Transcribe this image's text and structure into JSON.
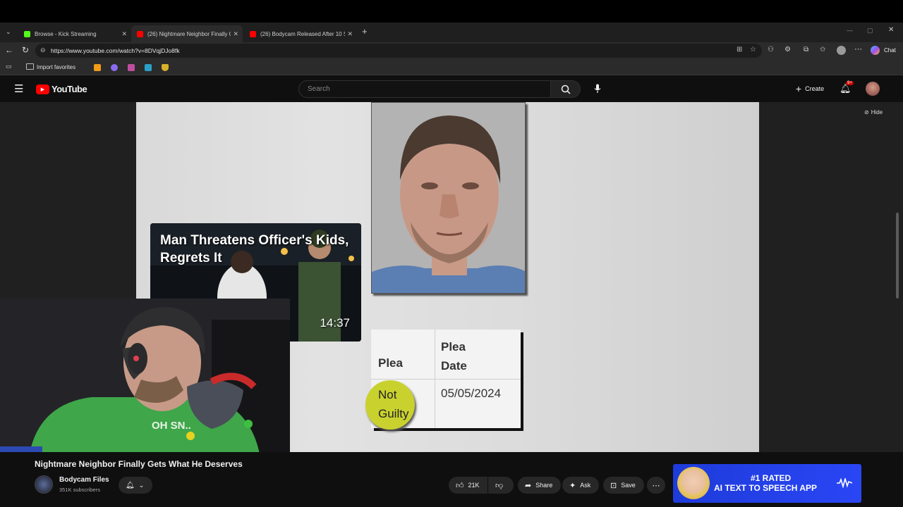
{
  "browser": {
    "tabs": [
      {
        "label": "Browse - Kick Streaming",
        "favicon_color": "#53fc18"
      },
      {
        "label": "(26) Nightmare Neighbor Finally G",
        "favicon_color": "#ff0000"
      },
      {
        "label": "(26) Bodycam Released After 10 S",
        "favicon_color": "#ff0000"
      }
    ],
    "url": "https://www.youtube.com/watch?v=8DVqjDJo8fk",
    "copilot_label": "Chat",
    "bookmarks": {
      "import_label": "Import favorites"
    }
  },
  "youtube": {
    "logo_text": "YouTube",
    "search_placeholder": "Search",
    "create_label": "Create",
    "notification_badge": "9+",
    "hide_label": "Hide"
  },
  "video_frame": {
    "thumbnail_title": "Man Threatens Officer's Kids, Regrets It",
    "thumbnail_duration": "14:37",
    "plea_table": {
      "headers": [
        "Plea",
        "Plea Date"
      ],
      "row": [
        "Not Guilty",
        "05/05/2024"
      ]
    },
    "shirt_text": "OH SN..."
  },
  "video_info": {
    "title": "Nightmare Neighbor Finally Gets What He Deserves",
    "channel": "Bodycam Files",
    "subscribers": "351K subscribers",
    "likes": "21K",
    "share_label": "Share",
    "ask_label": "Ask",
    "save_label": "Save"
  },
  "ad": {
    "line1": "#1 RATED",
    "line2": "AI TEXT TO SPEECH APP"
  },
  "colors": {
    "accent_red": "#ff0000",
    "ad_blue": "#2a46f5",
    "highlight_yellow": "#c9d12e"
  }
}
